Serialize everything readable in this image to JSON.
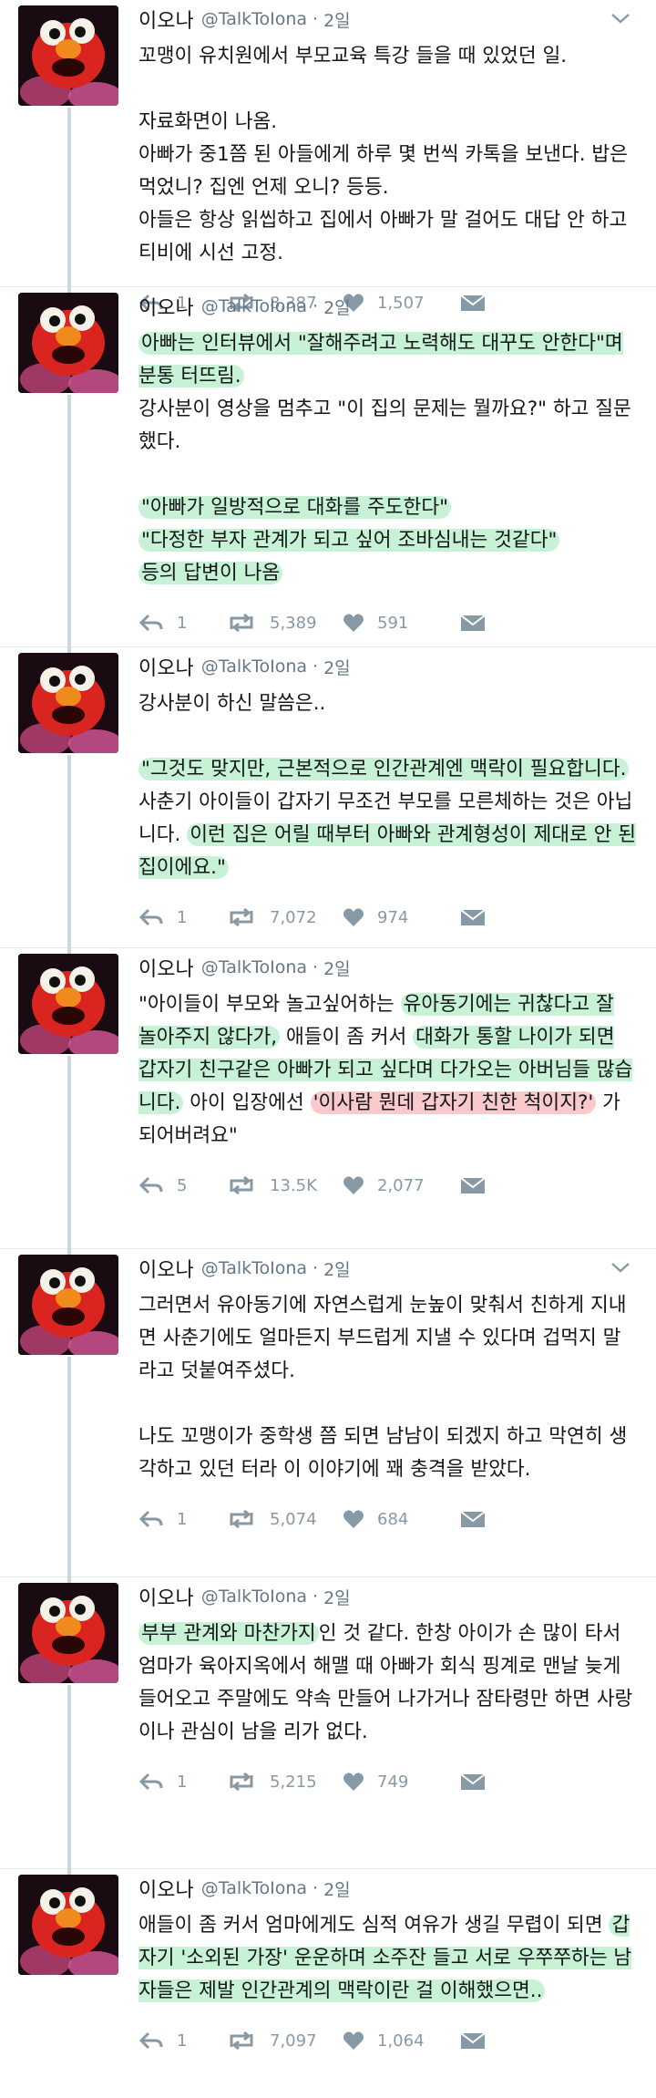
{
  "colors": {
    "highlight_green": "#c8f2d5",
    "highlight_red": "#f9c9cc",
    "icon_gray": "#8899a6",
    "thread_line": "#ccd6dd"
  },
  "icons": {
    "avatar": "elmo-avatar",
    "caret": "chevron-down-icon",
    "reply": "reply-icon",
    "retweet": "retweet-icon",
    "like": "heart-icon",
    "message": "envelope-icon"
  },
  "tweets": [
    {
      "name": "이오나",
      "handle": "@TalkToIona",
      "dot": "·",
      "time": "2일",
      "replies": "1",
      "retweets": "8,387",
      "likes": "1,507",
      "text": {
        "l1": "꼬맹이 유치원에서 부모교육 특강 들을 때 있었던 일.",
        "l2": "자료화면이 나옴.",
        "l3": "아빠가 중1쯤 된 아들에게 하루 몇 번씩 카톡을 보낸다. 밥은 먹었니? 집엔 언제 오니? 등등.",
        "l4": "아들은 항상 읽씹하고 집에서 아빠가 말 걸어도 대답 안 하고 티비에 시선 고정."
      }
    },
    {
      "name": "이오나",
      "handle": "@TalkToIona",
      "dot": "·",
      "time": "2일",
      "replies": "1",
      "retweets": "5,389",
      "likes": "591",
      "text": {
        "h1": "아빠는 인터뷰에서 \"잘해주려고 노력해도 대꾸도 안한다\"며 분통 터뜨림.",
        "l1": "강사분이 영상을 멈추고 \"이 집의 문제는 뭘까요?\" 하고 질문했다.",
        "h2": "\"아빠가 일방적으로 대화를 주도한다\"",
        "h3": "\"다정한 부자 관계가 되고 싶어 조바심내는 것같다\"",
        "h4": "등의 답변이 나옴"
      }
    },
    {
      "name": "이오나",
      "handle": "@TalkToIona",
      "dot": "·",
      "time": "2일",
      "replies": "1",
      "retweets": "7,072",
      "likes": "974",
      "text": {
        "l1": "강사분이 하신 말씀은..",
        "h1": "\"그것도 맞지만, 근본적으로 인간관계엔 맥락이 필요합니다.",
        "l2": " 사춘기 아이들이 갑자기 무조건 부모를 모른체하는 것은 아닙니다. ",
        "h2": "이런 집은 어릴 때부터 아빠와 관계형성이 제대로 안 된 집이에요.\""
      }
    },
    {
      "name": "이오나",
      "handle": "@TalkToIona",
      "dot": "·",
      "time": "2일",
      "replies": "5",
      "retweets": "13.5K",
      "likes": "2,077",
      "text": {
        "l1": "\"아이들이 부모와 놀고싶어하는 ",
        "h1": "유아동기에는 귀찮다고 잘 놀아주지 않다가,",
        "l2": " 애들이 좀 커서 ",
        "h2": "대화가 통할 나이가 되면 갑자기 친구같은 아빠가 되고 싶다며 다가오는 아버님들 많습니다.",
        "l3": " 아이 입장에선 ",
        "r1": "'이사람 뭔데 갑자기 친한 척이지?'",
        "l4": " 가 되어버려요\""
      }
    },
    {
      "name": "이오나",
      "handle": "@TalkToIona",
      "dot": "·",
      "time": "2일",
      "replies": "1",
      "retweets": "5,074",
      "likes": "684",
      "text": {
        "l1": "그러면서 유아동기에 자연스럽게 눈높이 맞춰서 친하게 지내면 사춘기에도 얼마든지 부드럽게 지낼 수 있다며 겁먹지 말라고 덧붙여주셨다.",
        "l2": "나도 꼬맹이가 중학생 쯤 되면 남남이 되겠지 하고 막연히 생각하고 있던 터라 이 이야기에 꽤 충격을 받았다."
      }
    },
    {
      "name": "이오나",
      "handle": "@TalkToIona",
      "dot": "·",
      "time": "2일",
      "replies": "1",
      "retweets": "5,215",
      "likes": "749",
      "text": {
        "h1": "부부 관계와 마찬가지",
        "l1": "인 것 같다. 한창 아이가 손 많이 타서 엄마가 육아지옥에서 해맬 때 아빠가 회식 핑계로 맨날 늦게 들어오고 주말에도 약속 만들어 나가거나 잠타령만 하면 사랑이나 관심이 남을 리가 없다."
      }
    },
    {
      "name": "이오나",
      "handle": "@TalkToIona",
      "dot": "·",
      "time": "2일",
      "replies": "1",
      "retweets": "7,097",
      "likes": "1,064",
      "text": {
        "l1": "애들이 좀 커서 엄마에게도 심적 여유가 생길 무렵이 되면 ",
        "h1": "갑자기 '소외된 가장' 운운하며 소주잔 들고 서로 우쭈쭈하는 남자들은 제발 인간관계의 맥락이란 걸 이해했으면..",
        "l2": ""
      }
    }
  ]
}
